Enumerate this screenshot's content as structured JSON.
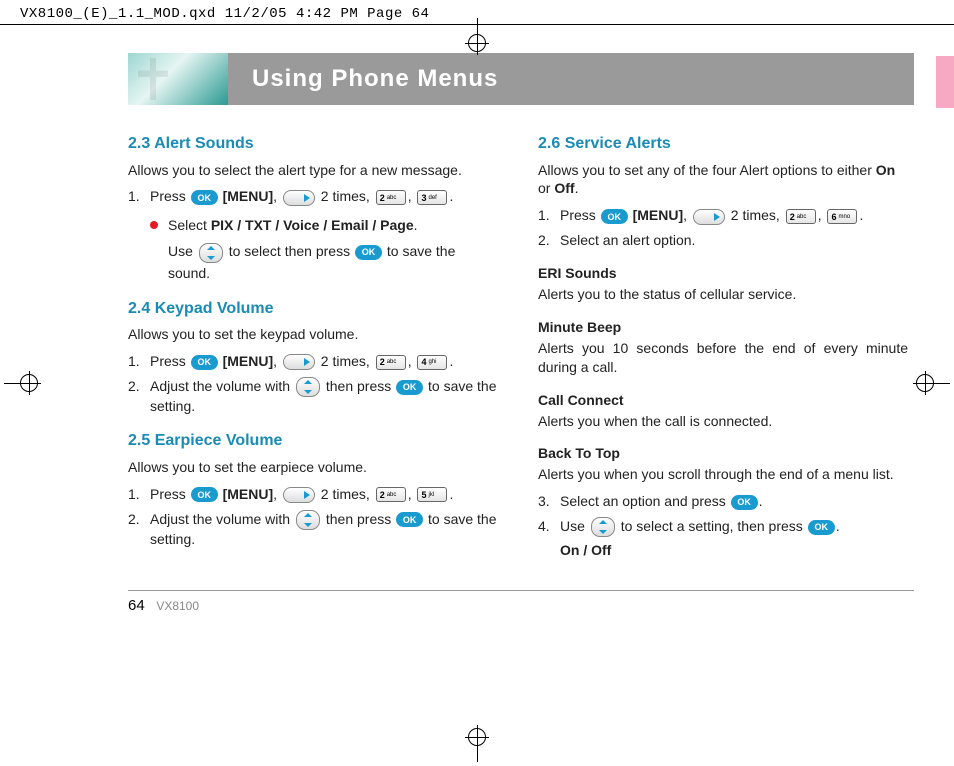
{
  "header": "VX8100_(E)_1.1_MOD.qxd  11/2/05  4:42 PM  Page 64",
  "banner_title": "Using Phone Menus",
  "left": {
    "s23": {
      "title": "2.3 Alert Sounds",
      "intro": "Allows you to select the alert type for a new message.",
      "step1_a": "Press",
      "step1_menu": "[MENU]",
      "step1_b": "2 times,",
      "sub_select": "Select ",
      "sub_options": "PIX / TXT / Voice / Email / Page",
      "sub_use_a": "Use",
      "sub_use_b": "to select then press",
      "sub_use_c": "to save the sound.",
      "key1": "2",
      "key1s": "abc",
      "key2": "3",
      "key2s": "def"
    },
    "s24": {
      "title": "2.4 Keypad Volume",
      "intro": "Allows you to set the keypad volume.",
      "step1_a": "Press",
      "step1_menu": "[MENU]",
      "step1_b": "2 times,",
      "step2_a": "Adjust the volume with",
      "step2_b": "then press",
      "step2_c": "to save the setting.",
      "key1": "2",
      "key1s": "abc",
      "key2": "4",
      "key2s": "ghi"
    },
    "s25": {
      "title": "2.5 Earpiece Volume",
      "intro": "Allows you to set the earpiece volume.",
      "step1_a": "Press",
      "step1_menu": "[MENU]",
      "step1_b": "2 times,",
      "step2_a": "Adjust the volume with",
      "step2_b": "then press",
      "step2_c": "to save the setting.",
      "key1": "2",
      "key1s": "abc",
      "key2": "5",
      "key2s": "jkl"
    }
  },
  "right": {
    "s26": {
      "title": "2.6 Service Alerts",
      "intro_a": "Allows you to set any of the four Alert options to either ",
      "intro_on": "On",
      "intro_b": " or ",
      "intro_off": "Off",
      "step1_a": "Press",
      "step1_menu": "[MENU]",
      "step1_b": "2 times,",
      "key1": "2",
      "key1s": "abc",
      "key2": "6",
      "key2s": "mno",
      "step2": "Select an alert option.",
      "eri_h": "ERI Sounds",
      "eri_t": "Alerts you to the status of cellular service.",
      "min_h": "Minute Beep",
      "min_t": "Alerts you 10 seconds before the end of every minute during a call.",
      "cc_h": "Call Connect",
      "cc_t": "Alerts you when the call is connected.",
      "bt_h": "Back To Top",
      "bt_t": "Alerts you when you scroll through the end of a menu list.",
      "step3_a": "Select an option and press",
      "step4_a": "Use",
      "step4_b": "to select a setting, then press",
      "onoff": "On / Off"
    }
  },
  "ok_label": "OK",
  "footer": {
    "page": "64",
    "model": "VX8100"
  }
}
